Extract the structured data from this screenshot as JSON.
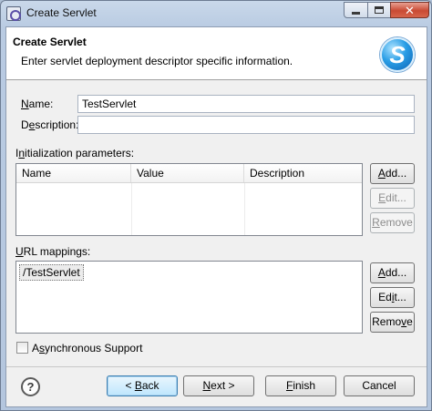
{
  "window": {
    "title": "Create Servlet",
    "close_glyph": "✕"
  },
  "banner": {
    "title": "Create Servlet",
    "description": "Enter servlet deployment descriptor specific information.",
    "logo_glyph": "S"
  },
  "form": {
    "name_label_key": "N",
    "name_label_rest": "ame:",
    "name_value": "TestServlet",
    "description_label_pre": "D",
    "description_label_key": "e",
    "description_label_rest": "scription:",
    "description_value": ""
  },
  "init_params": {
    "label_pre": "I",
    "label_key": "n",
    "label_rest": "itialization parameters:",
    "columns": [
      "Name",
      "Value",
      "Description"
    ],
    "add": {
      "key": "A",
      "rest": "dd..."
    },
    "edit": {
      "key": "E",
      "rest": "dit..."
    },
    "remove": {
      "key": "R",
      "rest": "emove"
    }
  },
  "url_mappings": {
    "label_key": "U",
    "label_rest": "RL mappings:",
    "items": [
      "/TestServlet"
    ],
    "add": {
      "key": "A",
      "rest": "dd..."
    },
    "edit": {
      "pre": "Ed",
      "key": "i",
      "rest": "t..."
    },
    "remove": {
      "pre": "Remo",
      "key": "v",
      "rest": "e"
    }
  },
  "async": {
    "label_pre": "A",
    "label_key": "s",
    "label_rest": "ynchronous Support",
    "checked": false
  },
  "footer": {
    "help_glyph": "?",
    "back": {
      "pre": "< ",
      "key": "B",
      "rest": "ack"
    },
    "next": {
      "key": "N",
      "rest": "ext >"
    },
    "finish": {
      "key": "F",
      "rest": "inish"
    },
    "cancel": "Cancel"
  }
}
